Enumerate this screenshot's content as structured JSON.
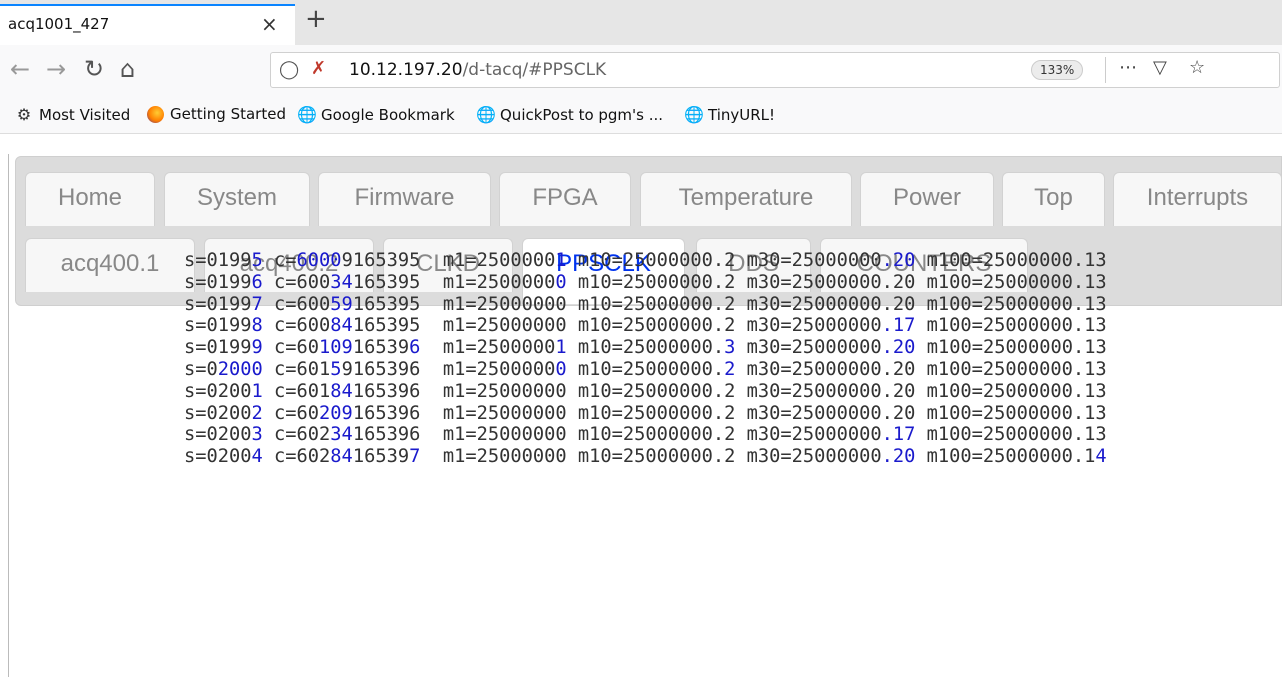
{
  "browser": {
    "tab_title": "acq1001_427",
    "tab_close": "×",
    "new_tab": "+",
    "url_host": "10.12.197.20",
    "url_path": "/d-tacq/#PPSCLK",
    "zoom": "133%",
    "bookmarks": [
      {
        "label": "Most Visited",
        "icon": "gear-icon"
      },
      {
        "label": "Getting Started",
        "icon": "firefox-icon"
      },
      {
        "label": "Google Bookmark",
        "icon": "globe-icon"
      },
      {
        "label": "QuickPost to pgm's ...",
        "icon": "globe-icon"
      },
      {
        "label": "TinyURL!",
        "icon": "globe-icon"
      }
    ]
  },
  "page": {
    "tabs_row1": [
      "Home",
      "System",
      "Firmware",
      "FPGA",
      "Temperature",
      "Power",
      "Top",
      "Interrupts"
    ],
    "tabs_row2": [
      "acq400.1",
      "acq400.2",
      "CLKD",
      "PPSCLK",
      "DDS",
      "COUNTERS"
    ],
    "active_tab": "PPSCLK",
    "highlight_color": "#1a1acc",
    "rows": [
      [
        [
          "s=0199",
          0
        ],
        [
          "5",
          1
        ],
        [
          " c=",
          0
        ],
        [
          "6000",
          1
        ],
        [
          "9165395  m1=2500000",
          0
        ],
        [
          "1",
          1
        ],
        [
          " m10=25000000.2 m30=25000000",
          0
        ],
        [
          ".20",
          1
        ],
        [
          " m100=25000000.13",
          0
        ]
      ],
      [
        [
          "s=0199",
          0
        ],
        [
          "6",
          1
        ],
        [
          " c=600",
          0
        ],
        [
          "34",
          1
        ],
        [
          "165395  m1=2500000",
          0
        ],
        [
          "0",
          1
        ],
        [
          " m10=25000000.2 m30=25000000.20 m100=25000000.13",
          0
        ]
      ],
      [
        [
          "s=0199",
          0
        ],
        [
          "7",
          1
        ],
        [
          " c=600",
          0
        ],
        [
          "59",
          1
        ],
        [
          "165395  m1=25000000 m10=25000000.2 m30=25000000.20 m100=25000000.13",
          0
        ]
      ],
      [
        [
          "s=0199",
          0
        ],
        [
          "8",
          1
        ],
        [
          " c=600",
          0
        ],
        [
          "84",
          1
        ],
        [
          "165395  m1=25000000 m10=25000000.2 m30=25000000",
          0
        ],
        [
          ".17",
          1
        ],
        [
          " m100=25000000.13",
          0
        ]
      ],
      [
        [
          "s=0199",
          0
        ],
        [
          "9",
          1
        ],
        [
          " c=60",
          0
        ],
        [
          "109",
          1
        ],
        [
          "16539",
          0
        ],
        [
          "6",
          1
        ],
        [
          "  m1=2500000",
          0
        ],
        [
          "1",
          1
        ],
        [
          " m10=25000000.",
          0
        ],
        [
          "3",
          1
        ],
        [
          " m30=25000000",
          0
        ],
        [
          ".20",
          1
        ],
        [
          " m100=25000000.13",
          0
        ]
      ],
      [
        [
          "s=0",
          0
        ],
        [
          "2000",
          1
        ],
        [
          " c=601",
          0
        ],
        [
          "5",
          1
        ],
        [
          "9165396  m1=2500000",
          0
        ],
        [
          "0",
          1
        ],
        [
          " m10=25000000.",
          0
        ],
        [
          "2",
          1
        ],
        [
          " m30=25000000.20 m100=25000000.13",
          0
        ]
      ],
      [
        [
          "s=0200",
          0
        ],
        [
          "1",
          1
        ],
        [
          " c=601",
          0
        ],
        [
          "84",
          1
        ],
        [
          "165396  m1=25000000 m10=25000000.2 m30=25000000.20 m100=25000000.13",
          0
        ]
      ],
      [
        [
          "s=0200",
          0
        ],
        [
          "2",
          1
        ],
        [
          " c=60",
          0
        ],
        [
          "209",
          1
        ],
        [
          "165396  m1=25000000 m10=25000000.2 m30=25000000.20 m100=25000000.13",
          0
        ]
      ],
      [
        [
          "s=0200",
          0
        ],
        [
          "3",
          1
        ],
        [
          " c=602",
          0
        ],
        [
          "34",
          1
        ],
        [
          "165396  m1=25000000 m10=25000000.2 m30=25000000",
          0
        ],
        [
          ".17",
          1
        ],
        [
          " m100=25000000.13",
          0
        ]
      ],
      [
        [
          "s=0200",
          0
        ],
        [
          "4",
          1
        ],
        [
          " c=602",
          0
        ],
        [
          "84",
          1
        ],
        [
          "16539",
          0
        ],
        [
          "7",
          1
        ],
        [
          "  m1=25000000 m10=25000000.2 m30=25000000",
          0
        ],
        [
          ".20",
          1
        ],
        [
          " m100=25000000.1",
          0
        ],
        [
          "4",
          1
        ]
      ]
    ]
  }
}
